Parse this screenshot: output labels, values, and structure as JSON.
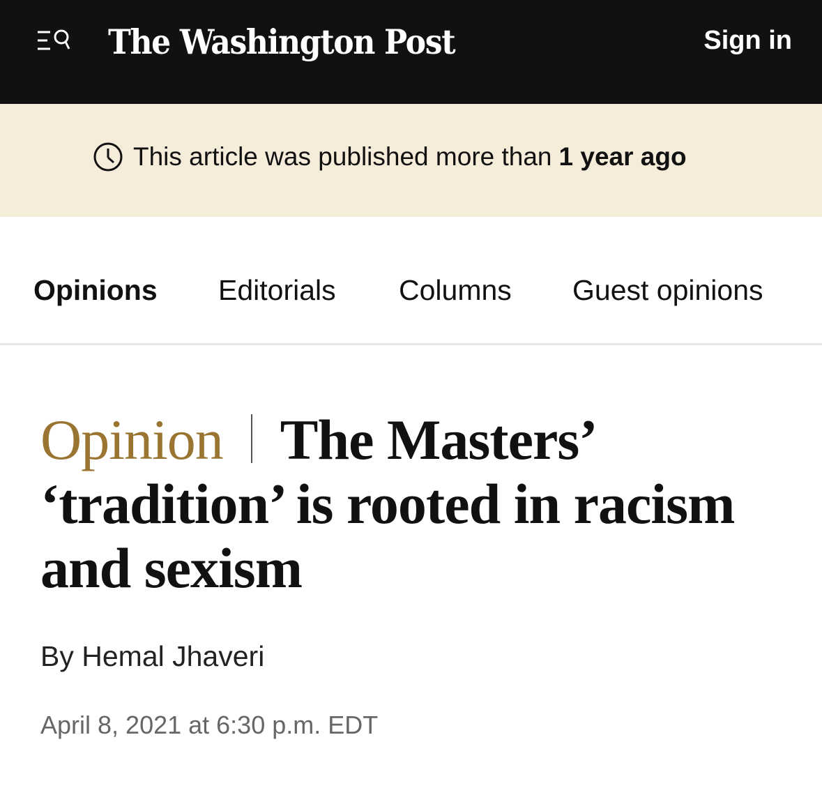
{
  "header": {
    "menu_icon": "menu-icon",
    "search_icon": "search-icon",
    "logo_text": "The Washington Post",
    "signin_label": "Sign in",
    "background_color": "#111111"
  },
  "notice": {
    "icon": "clock-icon",
    "text": "This article was published more than",
    "bold_text": "1 year ago",
    "background_color": "#f5ecd9"
  },
  "subnav": {
    "items": [
      {
        "label": "Opinions",
        "active": true
      },
      {
        "label": "Editorials",
        "active": false
      },
      {
        "label": "Columns",
        "active": false
      },
      {
        "label": "Guest opinions",
        "active": false
      }
    ]
  },
  "article": {
    "kicker": "Opinion",
    "kicker_color": "#9a7532",
    "title": "The Masters’ ‘tradition’ is rooted in racism and sexism",
    "byline_prefix": "By",
    "author": "Hemal Jhaveri",
    "dateline": "April 8, 2021 at 6:30 p.m. EDT"
  }
}
